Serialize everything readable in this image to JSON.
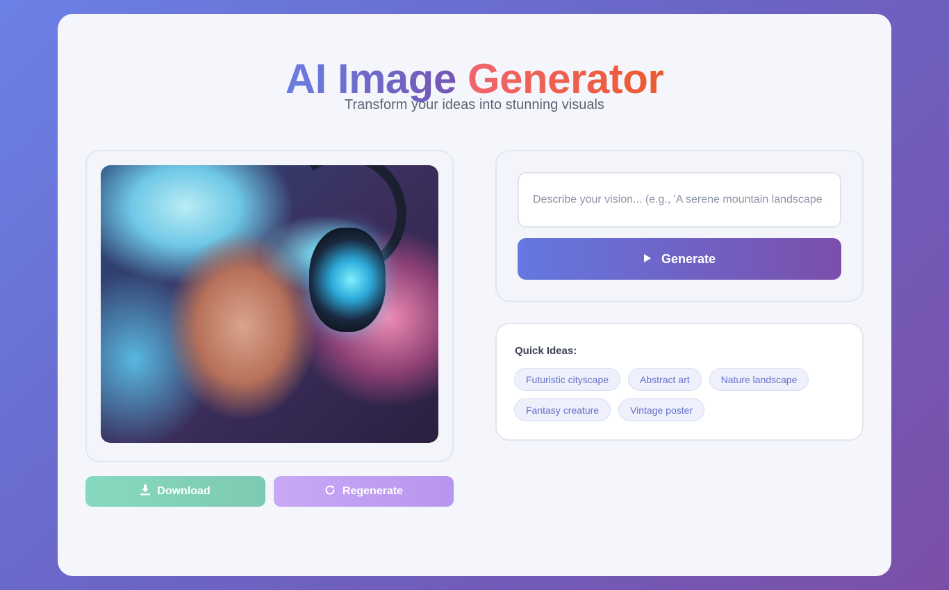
{
  "header": {
    "title_part1": "AI Image",
    "title_part2": "Generator",
    "subtitle": "Transform your ideas into stunning visuals"
  },
  "image_panel": {
    "buttons": {
      "download_label": "Download",
      "regenerate_label": "Regenerate"
    }
  },
  "prompt": {
    "placeholder": "Describe your vision... (e.g., 'A serene mountain landscape at sunset')",
    "value": "",
    "generate_label": "Generate"
  },
  "quick_ideas": {
    "title": "Quick Ideas:",
    "items": [
      "Futuristic cityscape",
      "Abstract art",
      "Nature landscape",
      "Fantasy creature",
      "Vintage poster"
    ]
  },
  "colors": {
    "download_button": "#86d9bf",
    "regenerate_button": "#c7a9f5",
    "generate_gradient_start": "#6478e0",
    "generate_gradient_end": "#7a4fab",
    "title_accent": "#ef5a3a"
  },
  "icons": {
    "download": "download-icon",
    "regenerate": "refresh-icon",
    "generate": "play-icon"
  }
}
